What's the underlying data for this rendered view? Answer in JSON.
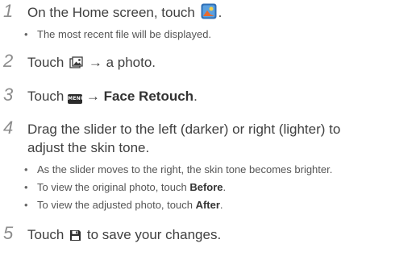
{
  "steps": [
    {
      "number": "1",
      "text_before": "On the Home screen, touch",
      "icon": "photo-editor-app-icon",
      "text_after": ".",
      "bullets": [
        "The most recent file will be displayed."
      ]
    },
    {
      "number": "2",
      "text_before": "Touch",
      "icon": "gallery-icon",
      "text_after": "→ a photo."
    },
    {
      "number": "3",
      "text_before": "Touch",
      "icon": "menu-key-icon",
      "icon_label": "MENU",
      "text_arrow": "→",
      "bold": "Face Retouch",
      "text_after": "."
    },
    {
      "number": "4",
      "line1": "Drag the slider to the left (darker) or right (lighter) to",
      "line2": "adjust the skin tone.",
      "bullets": [
        "As the slider moves to the right, the skin tone becomes brighter.",
        {
          "pre": "To view the original photo, touch ",
          "bold": "Before",
          "post": "."
        },
        {
          "pre": "To view the adjusted photo, touch ",
          "bold": "After",
          "post": "."
        }
      ]
    },
    {
      "number": "5",
      "text_before": "Touch",
      "icon": "save-icon",
      "text_after": "to save your changes."
    }
  ],
  "colors": {
    "number": "#8c8c8c",
    "text": "#404040"
  }
}
